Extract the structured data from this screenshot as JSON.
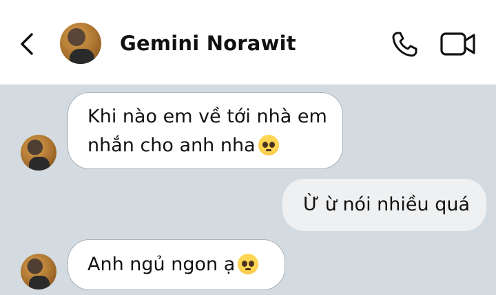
{
  "header": {
    "contact_name": "Gemini Norawit",
    "back_icon": "chevron-left-icon",
    "call_icon": "phone-icon",
    "video_icon": "video-camera-icon"
  },
  "messages": [
    {
      "direction": "incoming",
      "lines": [
        "Khi nào em về tới nhà em",
        "nhắn cho anh nha"
      ],
      "emoji": "pleading-face"
    },
    {
      "direction": "outgoing",
      "text": "Ừ ừ nói nhiều quá"
    },
    {
      "direction": "incoming",
      "text": "Anh ngủ ngon ạ",
      "emoji": "pleading-face"
    }
  ],
  "colors": {
    "background": "#d3dbe1",
    "header": "#ffffff",
    "incoming_bubble": "#ffffff",
    "outgoing_bubble": "#eff0f1"
  }
}
